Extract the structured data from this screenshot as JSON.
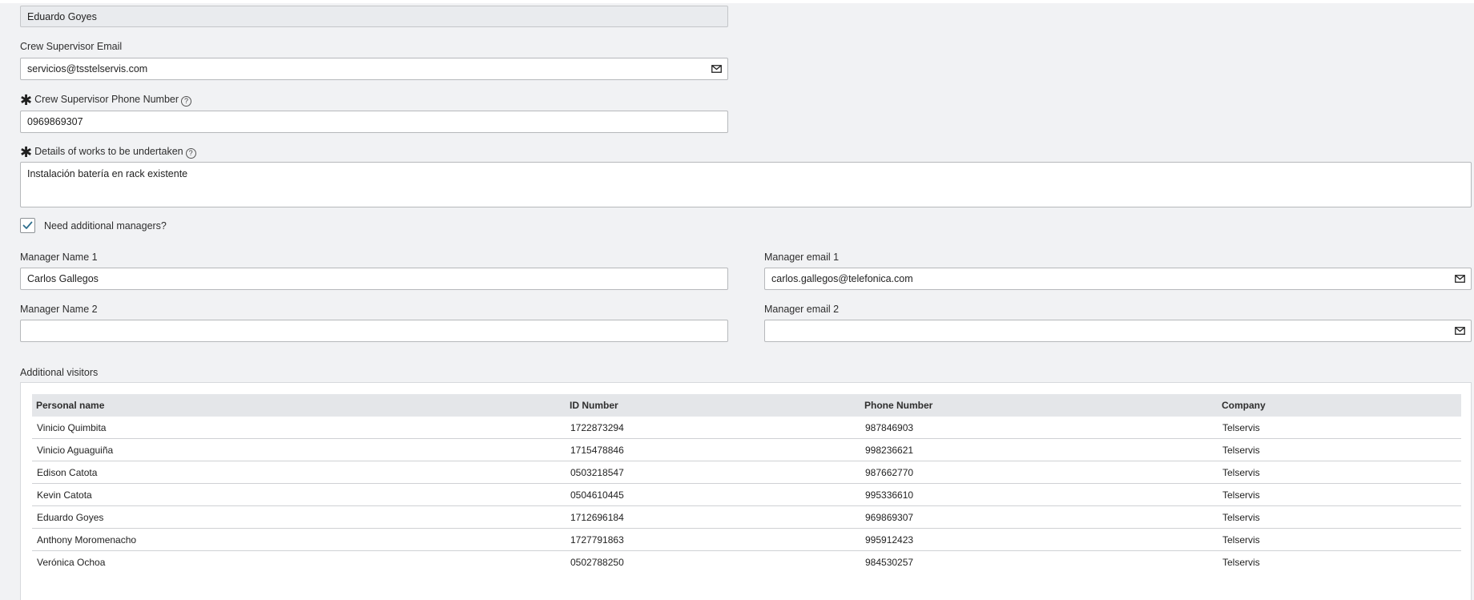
{
  "crew_supervisor": {
    "name_value": "Eduardo Goyes",
    "email_label": "Crew Supervisor Email",
    "email_value": "servicios@tsstelservis.com",
    "phone_label": "Crew Supervisor Phone Number",
    "phone_value": "0969869307"
  },
  "works": {
    "label": "Details of works to be undertaken",
    "value": "Instalación batería en rack existente"
  },
  "required_marker": "✱",
  "help_glyph": "?",
  "additional_managers": {
    "label": "Need additional managers?",
    "checked": true
  },
  "managers": [
    {
      "name_label": "Manager Name 1",
      "name_value": "Carlos Gallegos",
      "email_label": "Manager email 1",
      "email_value": "carlos.gallegos@telefonica.com"
    },
    {
      "name_label": "Manager Name 2",
      "name_value": "",
      "email_label": "Manager email 2",
      "email_value": ""
    }
  ],
  "visitors": {
    "label": "Additional visitors",
    "columns": [
      "Personal name",
      "ID Number",
      "Phone Number",
      "Company"
    ],
    "rows": [
      [
        "Vinicio Quimbita",
        "1722873294",
        "987846903",
        "Telservis"
      ],
      [
        "Vinicio Aguaguiña",
        "1715478846",
        "998236621",
        "Telservis"
      ],
      [
        "Edison Catota",
        "0503218547",
        "987662770",
        "Telservis"
      ],
      [
        "Kevin Catota",
        "0504610445",
        "995336610",
        "Telservis"
      ],
      [
        "Eduardo Goyes",
        "1712696184",
        "969869307",
        "Telservis"
      ],
      [
        "Anthony Moromenacho",
        "1727791863",
        "995912423",
        "Telservis"
      ],
      [
        "Verónica Ochoa",
        "0502788250",
        "984530257",
        "Telservis"
      ]
    ]
  },
  "icons": {
    "email_button": "envelope-icon",
    "checkbox": "checkmark-icon",
    "required": "asterisk-icon",
    "help": "help-circle-icon"
  },
  "colors": {
    "page_background": "#f1f2f4",
    "checkmark": "#2e6f8e",
    "readonly_field": "#e9ebee",
    "table_header": "#e4e6e9"
  }
}
